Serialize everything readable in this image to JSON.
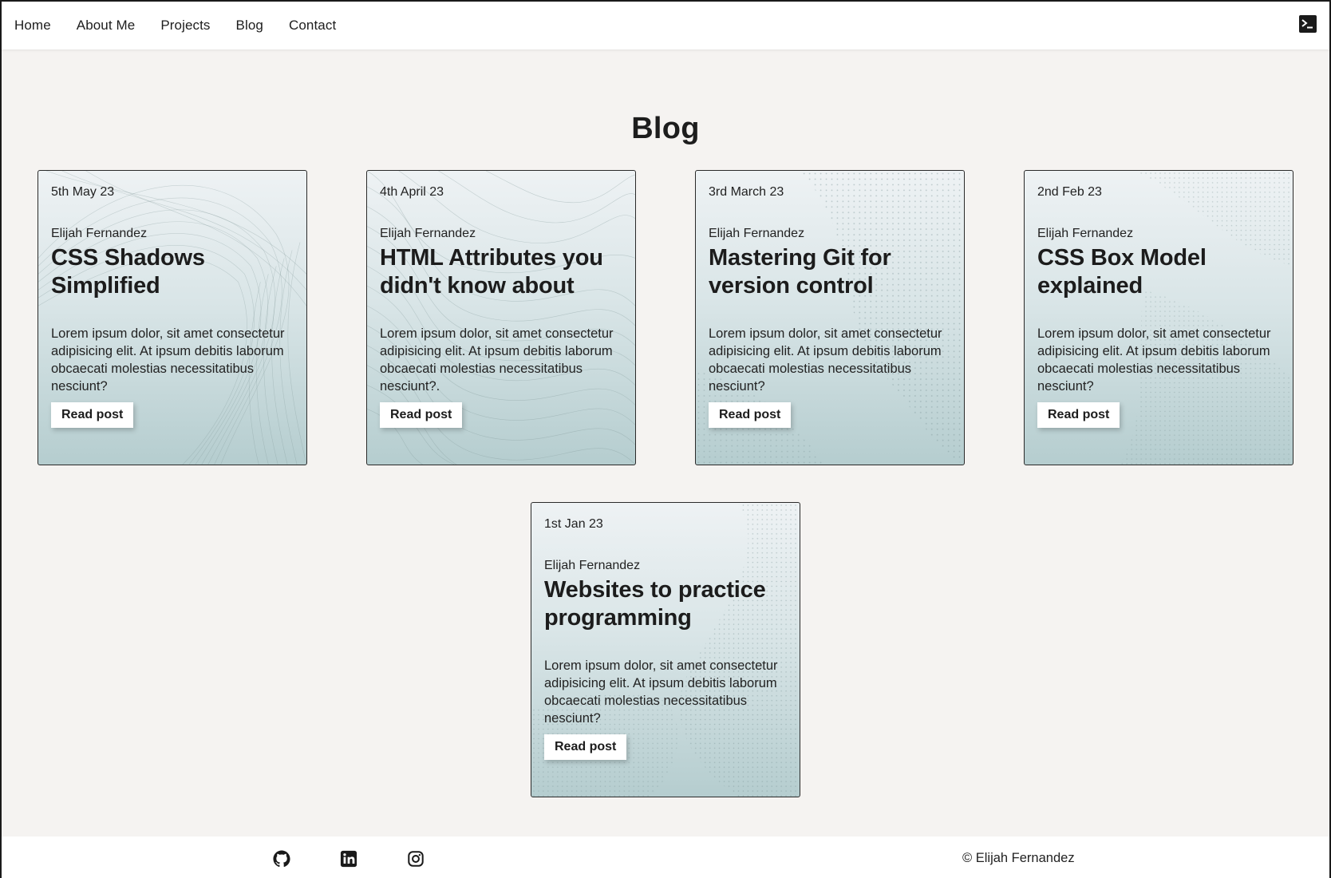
{
  "nav": {
    "links": [
      {
        "label": "Home"
      },
      {
        "label": "About Me"
      },
      {
        "label": "Projects"
      },
      {
        "label": "Blog"
      },
      {
        "label": "Contact"
      }
    ],
    "terminal_icon": "terminal-icon"
  },
  "page": {
    "title": "Blog"
  },
  "posts": [
    {
      "date": "5th May 23",
      "author": "Elijah Fernandez",
      "title": "CSS Shadows Simplified",
      "excerpt": "Lorem ipsum dolor, sit amet consectetur adipisicing elit. At ipsum debitis laborum obcaecati molestias necessitatibus nesciunt?",
      "button": "Read post"
    },
    {
      "date": "4th April 23",
      "author": "Elijah Fernandez",
      "title": "HTML Attributes you didn't know about",
      "excerpt": "Lorem ipsum dolor, sit amet consectetur adipisicing elit. At ipsum debitis laborum obcaecati molestias necessitatibus nesciunt?.",
      "button": "Read post"
    },
    {
      "date": "3rd March 23",
      "author": "Elijah Fernandez",
      "title": "Mastering Git for version control",
      "excerpt": "Lorem ipsum dolor, sit amet consectetur adipisicing elit. At ipsum debitis laborum obcaecati molestias necessitatibus nesciunt?",
      "button": "Read post"
    },
    {
      "date": "2nd Feb 23",
      "author": "Elijah Fernandez",
      "title": "CSS Box Model explained",
      "excerpt": "Lorem ipsum dolor, sit amet consectetur adipisicing elit. At ipsum debitis laborum obcaecati molestias necessitatibus nesciunt?",
      "button": "Read post"
    },
    {
      "date": "1st Jan 23",
      "author": "Elijah Fernandez",
      "title": "Websites to practice programming",
      "excerpt": "Lorem ipsum dolor, sit amet consectetur adipisicing elit. At ipsum debitis laborum obcaecati molestias necessitatibus nesciunt?",
      "button": "Read post"
    }
  ],
  "footer": {
    "icons": [
      "github-icon",
      "linkedin-icon",
      "instagram-icon"
    ],
    "copyright": "© Elijah Fernandez"
  }
}
